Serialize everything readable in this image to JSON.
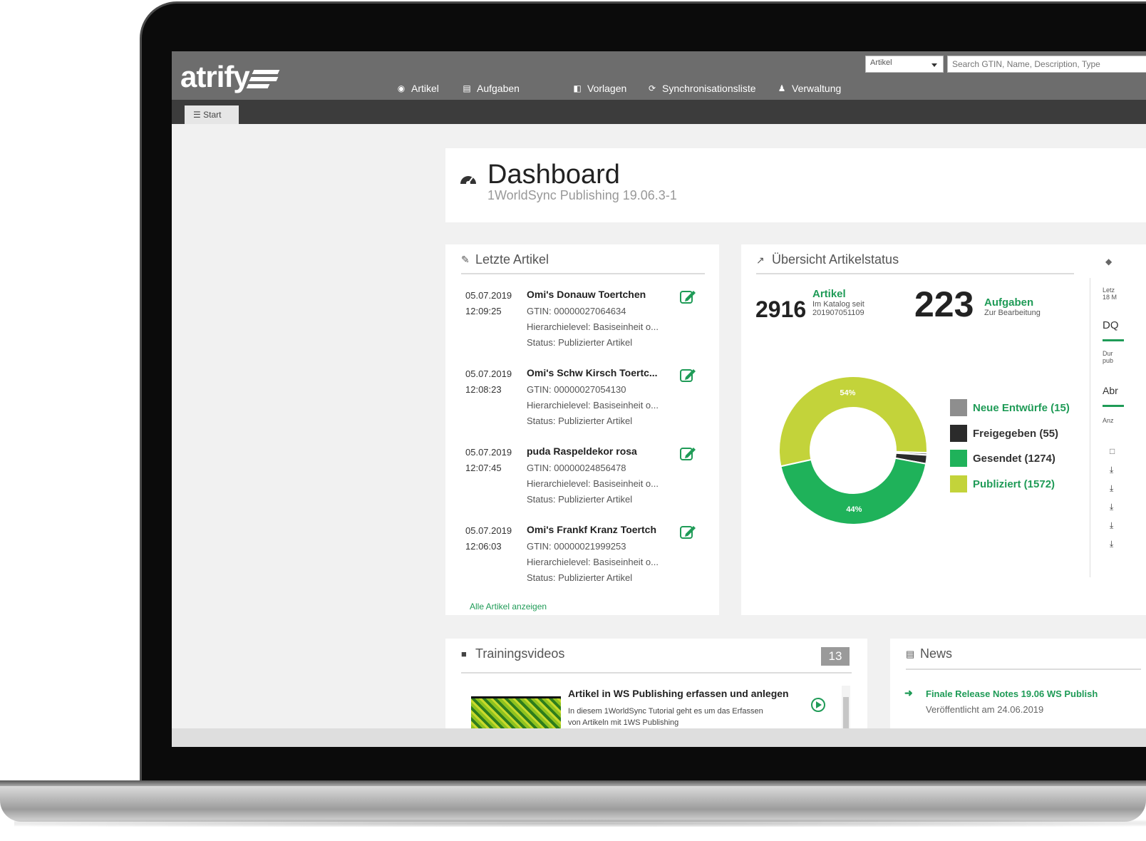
{
  "app": {
    "logo_text": "atrify",
    "nav": [
      {
        "label": "Artikel",
        "icon": "cube-icon"
      },
      {
        "label": "Aufgaben",
        "icon": "inbox-icon"
      },
      {
        "label": "Vorlagen",
        "icon": "copy-icon"
      },
      {
        "label": "Synchronisationsliste",
        "icon": "refresh-icon"
      },
      {
        "label": "Verwaltung",
        "icon": "users-icon"
      }
    ],
    "search": {
      "scope_value": "Artikel",
      "placeholder": "Search GTIN, Name, Description, Type"
    },
    "tab_start": "Start"
  },
  "dashboard": {
    "title": "Dashboard",
    "subtitle": "1WorldSync Publishing 19.06.3-1"
  },
  "letzte_artikel": {
    "title": "Letzte Artikel",
    "items": [
      {
        "date": "05.07.2019",
        "time": "12:09:25",
        "name": "Omi's Donauw Toertchen",
        "gtin": "GTIN: 00000027064634",
        "hierarchy": "Hierarchielevel: Basiseinheit o...",
        "status": "Status: Publizierter Artikel"
      },
      {
        "date": "05.07.2019",
        "time": "12:08:23",
        "name": "Omi's Schw Kirsch Toertc...",
        "gtin": "GTIN: 00000027054130",
        "hierarchy": "Hierarchielevel: Basiseinheit o...",
        "status": "Status: Publizierter Artikel"
      },
      {
        "date": "05.07.2019",
        "time": "12:07:45",
        "name": "puda Raspeldekor rosa",
        "gtin": "GTIN: 00000024856478",
        "hierarchy": "Hierarchielevel: Basiseinheit o...",
        "status": "Status: Publizierter Artikel"
      },
      {
        "date": "05.07.2019",
        "time": "12:06:03",
        "name": "Omi's Frankf Kranz Toertch",
        "gtin": "GTIN: 00000021999253",
        "hierarchy": "Hierarchielevel: Basiseinheit o...",
        "status": "Status: Publizierter Artikel"
      }
    ],
    "show_all": "Alle Artikel anzeigen"
  },
  "status_overview": {
    "title": "Übersicht Artikelstatus",
    "artikel_count": "2916",
    "artikel_label": "Artikel",
    "artikel_note_1": "Im Katalog seit",
    "artikel_note_2": "201907051109",
    "aufgaben_count": "223",
    "aufgaben_label": "Aufgaben",
    "aufgaben_note": "Zur Bearbeitung"
  },
  "chart_data": {
    "type": "pie",
    "donut": true,
    "categories": [
      "Neue Entwürfe",
      "Freigegeben",
      "Gesendet",
      "Publiziert"
    ],
    "values": [
      15,
      55,
      1274,
      1572
    ],
    "legend": [
      "Neue Entwürfe (15)",
      "Freigegeben (55)",
      "Gesendet (1274)",
      "Publiziert (1572)"
    ],
    "slice_labels": [
      "",
      "",
      "44%",
      "54%"
    ],
    "colors": [
      "#8e8e8e",
      "#2b2b2b",
      "#1fb25a",
      "#c3d33a"
    ],
    "legend_position": "right"
  },
  "trainingsvideos": {
    "title": "Trainingsvideos",
    "count": "13",
    "video_title": "Artikel in WS Publishing erfassen und anlegen",
    "video_desc_1": "In diesem 1WorldSync Tutorial geht es um das Erfassen",
    "video_desc_2": "von Artikeln mit 1WS Publishing"
  },
  "news": {
    "title": "News",
    "item_title": "Finale Release Notes 19.06 WS Publish",
    "item_date": "Veröffentlicht am 24.06.2019"
  },
  "right_panel": {
    "line_1": "Letz",
    "line_2": "18 M",
    "dq": "DQ",
    "dur": "Dur",
    "pub": "pub",
    "abr": "Abr",
    "anz": "Anz"
  },
  "colors": {
    "accent": "#1f9b57",
    "topbar": "#6d6d6d",
    "tabbar": "#3c3c3c"
  }
}
